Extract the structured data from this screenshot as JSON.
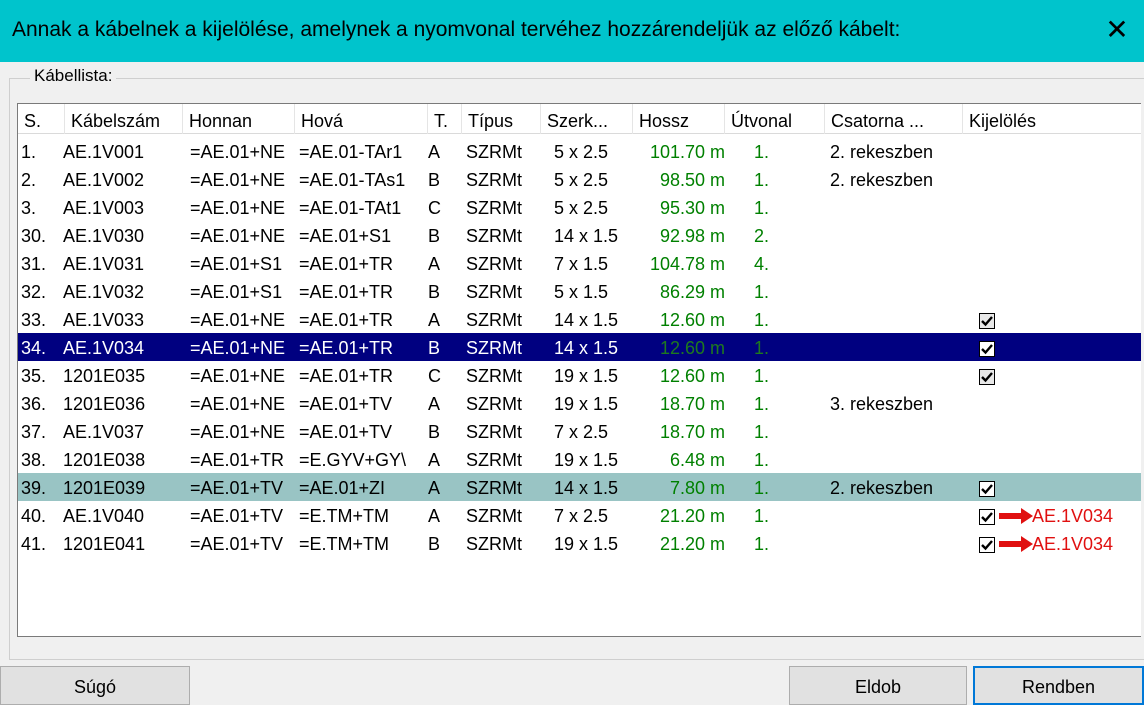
{
  "window": {
    "title": "Annak a kábelnek a kijelölése, amelynek a nyomvonal tervéhez hozzárendeljük az előző kábelt:",
    "close_symbol": "✕"
  },
  "group": {
    "label": "Kábellista:"
  },
  "columns": [
    "S.",
    "Kábelszám",
    "Honnan",
    "Hová",
    "T.",
    "Típus",
    "Szerk...",
    "Hossz",
    "Útvonal",
    "Csatorna ...",
    "Kijelölés"
  ],
  "rows": [
    {
      "s": "1.",
      "num": "AE.1V001",
      "from": "=AE.01+NE",
      "to": "=AE.01-TAr1",
      "t": "A",
      "type": "SZRMt",
      "struct": "5 x 2.5",
      "len": "101.70 m",
      "route": "1.",
      "channel": "2. rekeszben",
      "check": "none",
      "ref": ""
    },
    {
      "s": "2.",
      "num": "AE.1V002",
      "from": "=AE.01+NE",
      "to": "=AE.01-TAs1",
      "t": "B",
      "type": "SZRMt",
      "struct": "5 x 2.5",
      "len": "98.50 m",
      "route": "1.",
      "channel": "2. rekeszben",
      "check": "none",
      "ref": ""
    },
    {
      "s": "3.",
      "num": "AE.1V003",
      "from": "=AE.01+NE",
      "to": "=AE.01-TAt1",
      "t": "C",
      "type": "SZRMt",
      "struct": "5 x 2.5",
      "len": "95.30 m",
      "route": "1.",
      "channel": "",
      "check": "none",
      "ref": ""
    },
    {
      "s": "30.",
      "num": "AE.1V030",
      "from": "=AE.01+NE",
      "to": "=AE.01+S1",
      "t": "B",
      "type": "SZRMt",
      "struct": "14 x 1.5",
      "len": "92.98 m",
      "route": "2.",
      "channel": "",
      "check": "none",
      "ref": ""
    },
    {
      "s": "31.",
      "num": "AE.1V031",
      "from": "=AE.01+S1",
      "to": "=AE.01+TR",
      "t": "A",
      "type": "SZRMt",
      "struct": "7 x 1.5",
      "len": "104.78 m",
      "route": "4.",
      "channel": "",
      "check": "none",
      "ref": ""
    },
    {
      "s": "32.",
      "num": "AE.1V032",
      "from": "=AE.01+S1",
      "to": "=AE.01+TR",
      "t": "B",
      "type": "SZRMt",
      "struct": "5 x 1.5",
      "len": "86.29 m",
      "route": "1.",
      "channel": "",
      "check": "none",
      "ref": ""
    },
    {
      "s": "33.",
      "num": "AE.1V033",
      "from": "=AE.01+NE",
      "to": "=AE.01+TR",
      "t": "A",
      "type": "SZRMt",
      "struct": "14 x 1.5",
      "len": "12.60 m",
      "route": "1.",
      "channel": "",
      "check": "gray",
      "ref": ""
    },
    {
      "s": "34.",
      "num": "AE.1V034",
      "from": "=AE.01+NE",
      "to": "=AE.01+TR",
      "t": "B",
      "type": "SZRMt",
      "struct": "14 x 1.5",
      "len": "12.60 m",
      "route": "1.",
      "channel": "",
      "check": "white",
      "ref": "",
      "selected": "navy"
    },
    {
      "s": "35.",
      "num": "1201E035",
      "from": "=AE.01+NE",
      "to": "=AE.01+TR",
      "t": "C",
      "type": "SZRMt",
      "struct": "19 x 1.5",
      "len": "12.60 m",
      "route": "1.",
      "channel": "",
      "check": "gray",
      "ref": ""
    },
    {
      "s": "36.",
      "num": "1201E036",
      "from": "=AE.01+NE",
      "to": "=AE.01+TV",
      "t": "A",
      "type": "SZRMt",
      "struct": "19 x 1.5",
      "len": "18.70 m",
      "route": "1.",
      "channel": "3. rekeszben",
      "check": "none",
      "ref": ""
    },
    {
      "s": "37.",
      "num": "AE.1V037",
      "from": "=AE.01+NE",
      "to": "=AE.01+TV",
      "t": "B",
      "type": "SZRMt",
      "struct": "7 x 2.5",
      "len": "18.70 m",
      "route": "1.",
      "channel": "",
      "check": "none",
      "ref": ""
    },
    {
      "s": "38.",
      "num": "1201E038",
      "from": "=AE.01+TR",
      "to": "=E.GYV+GY\\",
      "t": "A",
      "type": "SZRMt",
      "struct": "19 x 1.5",
      "len": "6.48 m",
      "route": "1.",
      "channel": "",
      "check": "none",
      "ref": ""
    },
    {
      "s": "39.",
      "num": "1201E039",
      "from": "=AE.01+TV",
      "to": "=AE.01+ZI",
      "t": "A",
      "type": "SZRMt",
      "struct": "14 x 1.5",
      "len": "7.80 m",
      "route": "1.",
      "channel": "2. rekeszben",
      "check": "white",
      "ref": "",
      "selected": "teal"
    },
    {
      "s": "40.",
      "num": "AE.1V040",
      "from": "=AE.01+TV",
      "to": "=E.TM+TM",
      "t": "A",
      "type": "SZRMt",
      "struct": "7 x 2.5",
      "len": "21.20 m",
      "route": "1.",
      "channel": "",
      "check": "white",
      "ref": "AE.1V034"
    },
    {
      "s": "41.",
      "num": "1201E041",
      "from": "=AE.01+TV",
      "to": "=E.TM+TM",
      "t": "B",
      "type": "SZRMt",
      "struct": "19 x 1.5",
      "len": "21.20 m",
      "route": "1.",
      "channel": "",
      "check": "white",
      "ref": "AE.1V034"
    }
  ],
  "buttons": {
    "help": "Súgó",
    "discard": "Eldob",
    "ok": "Rendben"
  },
  "colors": {
    "titlebar": "#00C4CC",
    "selection": "#000080",
    "highlight": "#99C4C4",
    "length_text": "#008000",
    "link_arrow": "#E01010"
  }
}
